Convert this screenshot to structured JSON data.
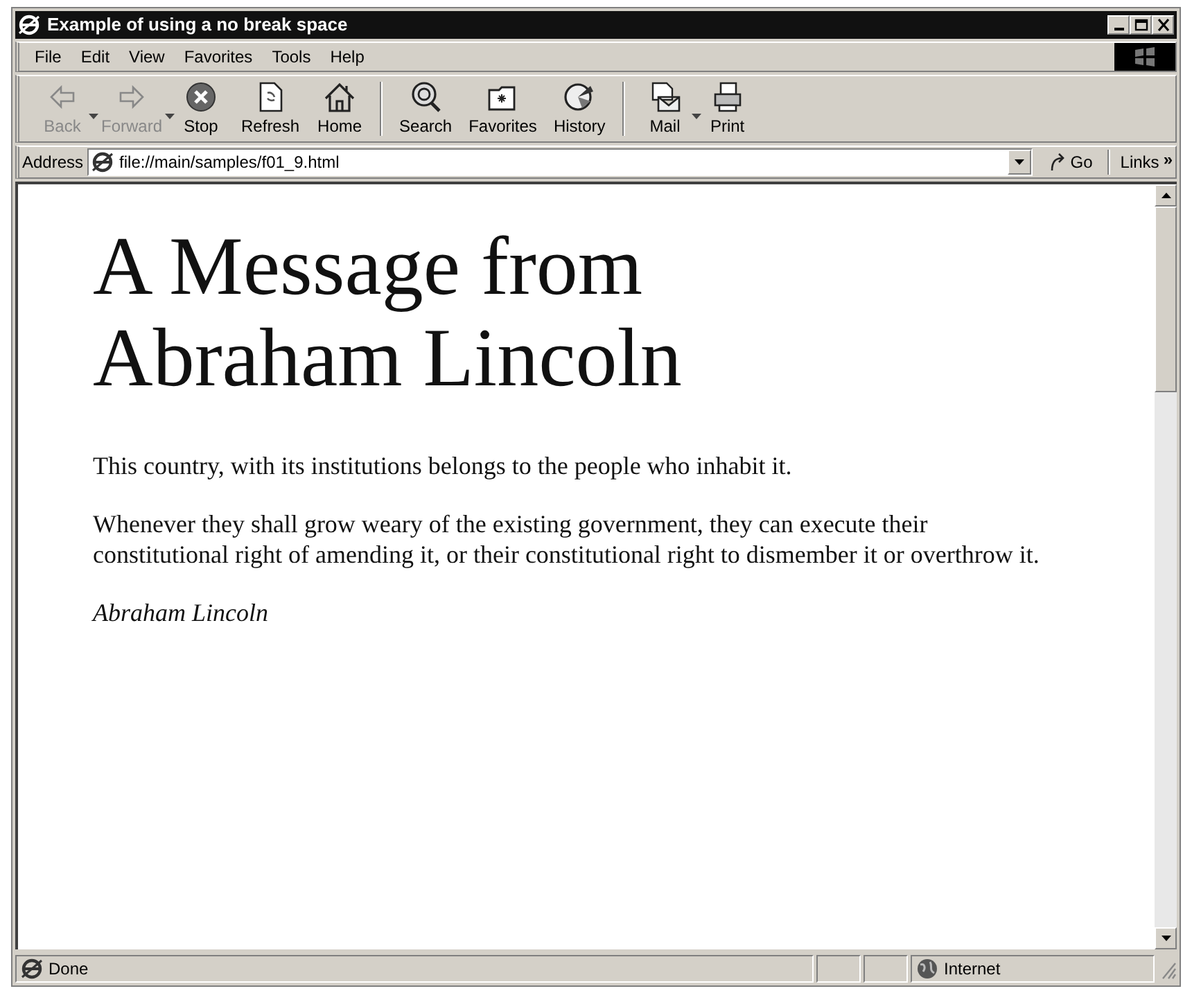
{
  "window": {
    "title": "Example of using a no break space"
  },
  "menu": [
    "File",
    "Edit",
    "View",
    "Favorites",
    "Tools",
    "Help"
  ],
  "toolbar": [
    [
      {
        "label": "Back",
        "disabled": true,
        "dropdown": true
      },
      {
        "label": "Forward",
        "disabled": true,
        "dropdown": true
      },
      {
        "label": "Stop",
        "disabled": false,
        "dropdown": false
      },
      {
        "label": "Refresh",
        "disabled": false,
        "dropdown": false
      },
      {
        "label": "Home",
        "disabled": false,
        "dropdown": false
      }
    ],
    [
      {
        "label": "Search",
        "disabled": false,
        "dropdown": false
      },
      {
        "label": "Favorites",
        "disabled": false,
        "dropdown": false
      },
      {
        "label": "History",
        "disabled": false,
        "dropdown": false
      }
    ],
    [
      {
        "label": "Mail",
        "disabled": false,
        "dropdown": true
      },
      {
        "label": "Print",
        "disabled": false,
        "dropdown": false
      }
    ]
  ],
  "address_bar": {
    "label": "Address",
    "value": "file://main/samples/f01_9.html",
    "go": "Go",
    "links": "Links",
    "more": "»"
  },
  "page": {
    "heading": "A Message from Abraham Lincoln",
    "paragraphs": [
      "This country, with its institutions belongs to the people who inhabit it.",
      "Whenever they shall grow weary of the existing government, they can execute their constitutional right of amending it, or their constitutional right to dismember it or overthrow it."
    ],
    "signature": "Abraham Lincoln"
  },
  "status_bar": {
    "text": "Done",
    "zone": "Internet"
  }
}
